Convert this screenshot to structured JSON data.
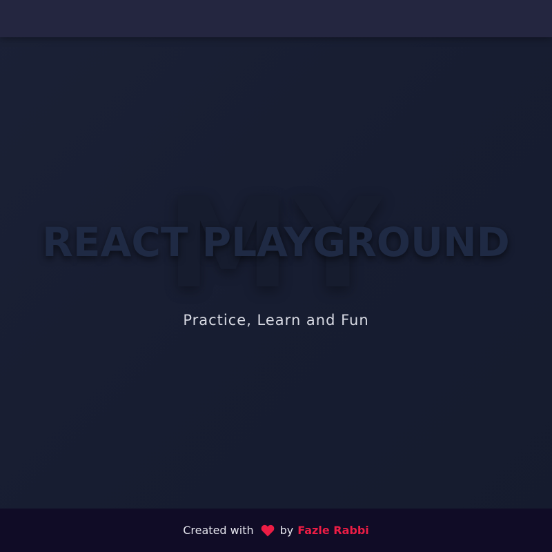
{
  "hero": {
    "background_word": "MY",
    "title": "REACT PLAYGROUND",
    "subtitle": "Practice, Learn and Fun"
  },
  "footer": {
    "created_with": "Created with",
    "heart_icon": "heart-icon",
    "by": "by",
    "author": "Fazle Rabbi"
  },
  "colors": {
    "background": "#171d31",
    "topbar": "#242640",
    "footer": "#100c26",
    "accent": "#ec1d45"
  }
}
